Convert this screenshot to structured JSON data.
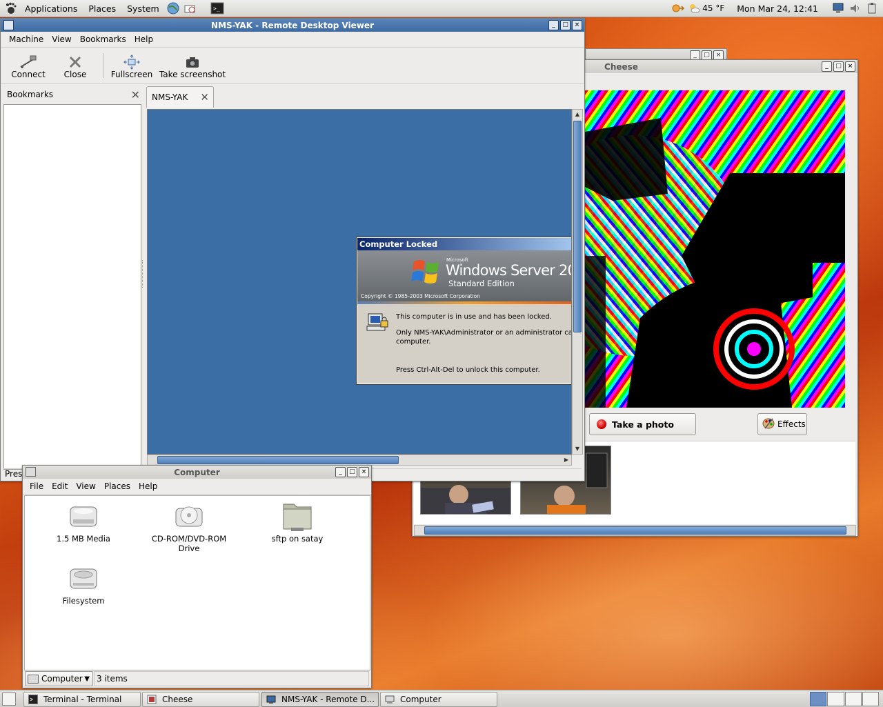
{
  "top_panel": {
    "menus": [
      "Applications",
      "Places",
      "System"
    ],
    "weather": "45 °F",
    "clock": "Mon Mar 24, 12:41",
    "colors": {
      "accent": "#3d6aa3"
    }
  },
  "rdv": {
    "title": "NMS-YAK - Remote Desktop Viewer",
    "menus": [
      "Machine",
      "View",
      "Bookmarks",
      "Help"
    ],
    "toolbar": {
      "connect": "Connect",
      "close": "Close",
      "fullscreen": "Fullscreen",
      "screenshot": "Take screenshot"
    },
    "bookmarks_label": "Bookmarks",
    "tab_label": "NMS-YAK",
    "status_partial": "Pres",
    "locked": {
      "title": "Computer Locked",
      "brand_small": "Microsoft",
      "brand": "Windows Server 20",
      "edition": "Standard Edition",
      "copyright": "Copyright © 1985-2003  Microsoft Corporation",
      "line1": "This computer is in use and has been locked.",
      "line2": "Only NMS-YAK\\Administrator or an administrator can",
      "line3": "computer.",
      "line4": "Press Ctrl-Alt-Del to unlock this computer."
    }
  },
  "cheese": {
    "title": "Cheese",
    "take_photo": "Take a photo",
    "effects": "Effects"
  },
  "computer": {
    "title": "Computer",
    "menus": [
      "File",
      "Edit",
      "View",
      "Places",
      "Help"
    ],
    "items": [
      {
        "label": "1.5 MB Media",
        "icon": "floppy-icon"
      },
      {
        "label": "CD-ROM/DVD-ROM Drive",
        "icon": "cdrom-icon"
      },
      {
        "label": "sftp on satay",
        "icon": "folder-icon"
      },
      {
        "label": "Filesystem",
        "icon": "harddisk-icon"
      }
    ],
    "location": "Computer",
    "status": "3 items"
  },
  "taskbar": {
    "tasks": [
      {
        "label": "Terminal - Terminal"
      },
      {
        "label": "Cheese"
      },
      {
        "label": "NMS-YAK - Remote D..."
      },
      {
        "label": "Computer"
      }
    ]
  }
}
